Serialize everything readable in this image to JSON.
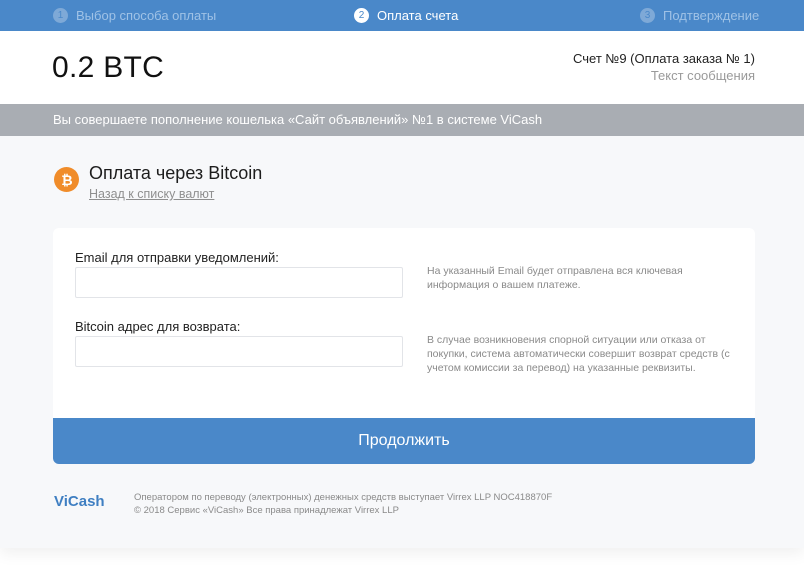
{
  "stepper": {
    "steps": [
      {
        "num": "1",
        "label": "Выбор способа оплаты"
      },
      {
        "num": "2",
        "label": "Оплата счета"
      },
      {
        "num": "3",
        "label": "Подтверждение"
      }
    ],
    "active_step": 2
  },
  "header": {
    "amount": "0.2 BTC",
    "invoice": "Счет №9 (Оплата заказа № 1)",
    "message": "Текст сообщения"
  },
  "info_bar": {
    "text": "Вы совершаете пополнение кошелька «Сайт объявлений» №1 в системе ViCash"
  },
  "payment": {
    "icon": "bitcoin-icon",
    "title": "Оплата через Bitcoin",
    "back_link": "Назад к списку валют"
  },
  "form": {
    "email": {
      "label": "Email для отправки уведомлений:",
      "value": "",
      "placeholder": "",
      "hint": "На указанный Email будет отправлена вся ключевая информация о вашем платеже."
    },
    "refund": {
      "label": "Bitcoin адрес для возврата:",
      "value": "",
      "placeholder": "",
      "hint": "В случае возникновения спорной ситуации или отказа от покупки, система автоматически совершит возврат средств (с учетом комиссии за перевод) на указанные реквизиты."
    }
  },
  "continue_button": {
    "label": "Продолжить"
  },
  "footer": {
    "logo": "ViCash",
    "line1": "Оператором по переводу (электронных) денежных средств выступает Virrex LLP NOC418870F",
    "line2": "© 2018 Сервис «ViCash» Все права принадлежат Virrex LLP"
  },
  "colors": {
    "accent": "#4a88c9",
    "info_bar": "#a9adb3",
    "bitcoin": "#f08c2a",
    "logo": "#3f7fc2"
  }
}
